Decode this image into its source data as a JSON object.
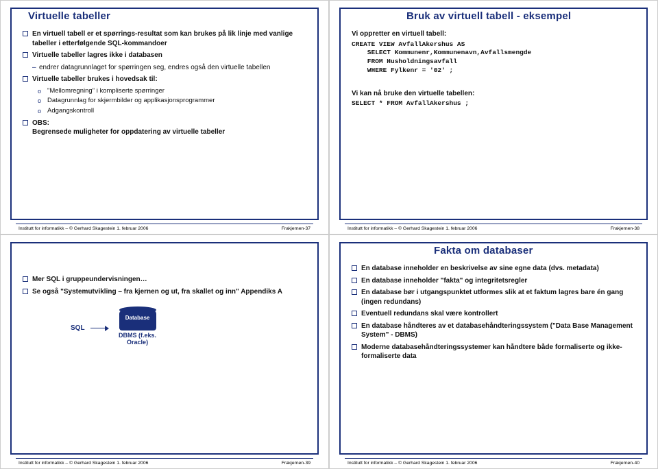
{
  "footer": {
    "left": "Institutt for informatikk – © Gerhard Skagestein 1. februar 2006"
  },
  "slides": {
    "s1": {
      "title": "Virtuelle tabeller",
      "b1": "En virtuell tabell er et spørrings-resultat som kan brukes på lik linje med vanlige tabeller i etterfølgende SQL-kommandoer",
      "b2": "Virtuelle tabeller lagres ikke i databasen",
      "b2a": "endrer datagrunnlaget for spørringen seg, endres også den virtuelle tabellen",
      "b3": "Virtuelle tabeller brukes i hovedsak til:",
      "o1": "\"Mellomregning\" i kompliserte spørringer",
      "o2": "Datagrunnlag for skjermbilder og applikasjonsprogrammer",
      "o3": "Adgangskontroll",
      "b4a": "OBS:",
      "b4b": "Begrensede muligheter for oppdatering av virtuelle tabeller",
      "page": "Frakjernen-37"
    },
    "s2": {
      "title": "Bruk av virtuell tabell - eksempel",
      "i1": "Vi oppretter en virtuell tabell:",
      "c1": "CREATE VIEW AvfallAkershus AS\n    SELECT Kommunenr,Kommunenavn,Avfallsmengde\n    FROM Husholdningsavfall\n    WHERE Fylkenr = '02' ;",
      "i2": "Vi kan nå bruke den virtuelle tabellen:",
      "c2": "SELECT * FROM AvfallAkershus ;",
      "page": "Frakjernen-38"
    },
    "s3": {
      "b1": "Mer SQL i gruppeundervisningen…",
      "b2": "Se også \"Systemutvikling – fra kjernen og ut, fra skallet og inn\" Appendiks A",
      "sql": "SQL",
      "dbcap": "DBMS\n(f.eks. Oracle)",
      "page": "Frakjernen-39"
    },
    "s4": {
      "title": "Fakta om databaser",
      "b1": "En database inneholder en beskrivelse av sine egne data (dvs. metadata)",
      "b2": "En database inneholder \"fakta\" og integritetsregler",
      "b3": "En database bør i utgangspunktet utformes slik at et faktum lagres bare én gang (ingen redundans)",
      "b4": "Eventuell redundans skal være kontrollert",
      "b5": "En database håndteres av et databasehåndteringssystem (\"Data Base Management System\" - DBMS)",
      "b6": "Moderne databasehåndteringssystemer kan håndtere både formaliserte og ikke-formaliserte data",
      "page": "Frakjernen-40"
    }
  }
}
